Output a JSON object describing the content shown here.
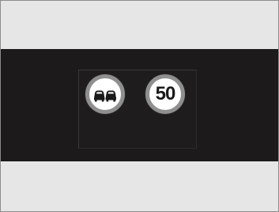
{
  "signs": {
    "no_overtaking": {
      "icon": "no-overtaking-icon"
    },
    "speed_limit": {
      "icon": "speed-limit-icon",
      "value": "50"
    }
  },
  "colors": {
    "background_light": "#e6e6e6",
    "band_dark": "#1c1a1a",
    "sign_ring": "#8f8f8f",
    "sign_face": "#ffffff",
    "symbol": "#1a1a1a"
  }
}
